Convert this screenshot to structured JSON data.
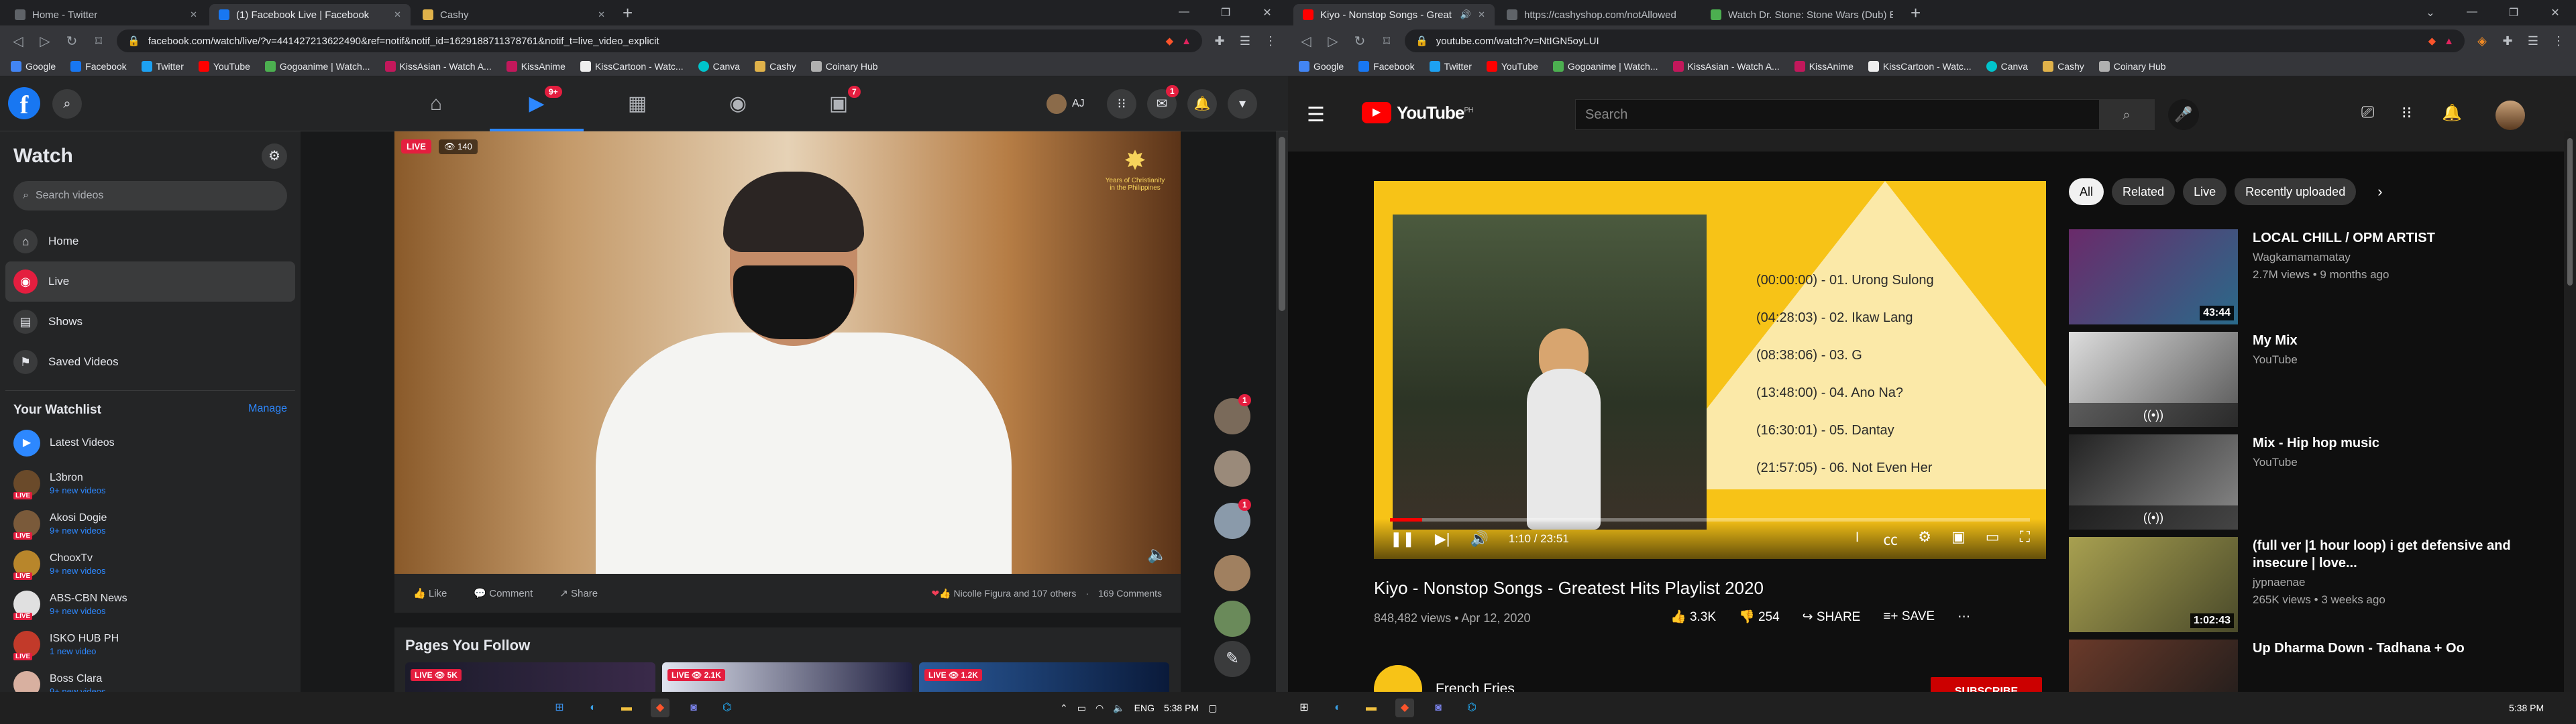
{
  "left_browser": {
    "tabs": [
      {
        "title": "Home - Twitter",
        "active": false
      },
      {
        "title": "(1) Facebook Live | Facebook",
        "active": true
      },
      {
        "title": "Cashy",
        "active": false
      }
    ],
    "url": "facebook.com/watch/live/?v=441427213622490&ref=notif&notif_id=1629188711378761&notif_t=live_video_explicit",
    "bookmarks": [
      "Google",
      "Facebook",
      "Twitter",
      "YouTube",
      "Gogoanime | Watch...",
      "KissAsian - Watch A...",
      "KissAnime",
      "KissCartoon - Watc...",
      "Canva",
      "Cashy",
      "Coinary Hub"
    ]
  },
  "facebook": {
    "user": "AJ",
    "nav_badges": {
      "watch": "9+",
      "gaming": "7",
      "messenger": "1"
    },
    "sidebar": {
      "title": "Watch",
      "search_placeholder": "Search videos",
      "items": [
        {
          "label": "Home",
          "icon": "home-icon"
        },
        {
          "label": "Live",
          "icon": "live-icon"
        },
        {
          "label": "Shows",
          "icon": "shows-icon"
        },
        {
          "label": "Saved Videos",
          "icon": "bookmark-icon"
        }
      ],
      "watchlist_title": "Your Watchlist",
      "manage": "Manage",
      "latest": "Latest Videos",
      "watchlist": [
        {
          "name": "L3bron",
          "sub": "9+ new videos"
        },
        {
          "name": "Akosi Dogie",
          "sub": "9+ new videos"
        },
        {
          "name": "ChooxTv",
          "sub": "9+ new videos"
        },
        {
          "name": "ABS-CBN News",
          "sub": "9+ new videos"
        },
        {
          "name": "ISKO HUB PH",
          "sub": "1 new video"
        },
        {
          "name": "Boss Clara",
          "sub": "9+ new videos"
        }
      ]
    },
    "video": {
      "live": "LIVE",
      "viewers": "140",
      "logo_text": "Years of Christianity in the Philippines"
    },
    "actions": {
      "like": "Like",
      "comment": "Comment",
      "share": "Share",
      "reactions": "Nicolle Figura and 107 others",
      "comments": "169 Comments"
    },
    "pages_title": "Pages You Follow",
    "page_cards": [
      {
        "live": "LIVE",
        "views": "5K"
      },
      {
        "live": "LIVE",
        "views": "2.1K"
      },
      {
        "live": "LIVE",
        "views": "1.2K"
      }
    ],
    "side_badges": [
      "1",
      "1"
    ]
  },
  "right_browser": {
    "tabs": [
      {
        "title": "Kiyo - Nonstop Songs - Great",
        "active": true
      },
      {
        "title": "https://cashyshop.com/notAllowed",
        "active": false
      },
      {
        "title": "Watch Dr. Stone: Stone Wars (Dub) Ep",
        "active": false
      }
    ],
    "url": "youtube.com/watch?v=NtIGN5oyLUI",
    "bookmarks": [
      "Google",
      "Facebook",
      "Twitter",
      "YouTube",
      "Gogoanime | Watch...",
      "KissAsian - Watch A...",
      "KissAnime",
      "KissCartoon - Watc...",
      "Canva",
      "Cashy",
      "Coinary Hub"
    ]
  },
  "youtube": {
    "logo": "YouTube",
    "region": "PH",
    "search_placeholder": "Search",
    "tracks": [
      "(00:00:00) - 01. Urong Sulong",
      "(04:28:03) - 02. Ikaw Lang",
      "(08:38:06) - 03. G",
      "(13:48:00) - 04. Ano Na?",
      "(16:30:01) - 05. Dantay",
      "(21:57:05) - 06. Not Even Her"
    ],
    "time": "1:10 / 23:51",
    "progress": 0.05,
    "title": "Kiyo - Nonstop Songs - Greatest Hits Playlist 2020",
    "meta": "848,482 views • Apr 12, 2020",
    "likes": "3.3K",
    "dislikes": "254",
    "share": "SHARE",
    "save": "SAVE",
    "channel": "French Fries",
    "subscribe": "SUBSCRIBE",
    "chips": [
      "All",
      "Related",
      "Live",
      "Recently uploaded"
    ],
    "recs": [
      {
        "title": "LOCAL CHILL / OPM ARTIST",
        "channel": "Wagkamamamatay",
        "meta": "2.7M views • 9 months ago",
        "dur": "43:44",
        "mix": false
      },
      {
        "title": "My Mix",
        "channel": "YouTube",
        "meta": "",
        "dur": "",
        "mix": true
      },
      {
        "title": "Mix - Hip hop music",
        "channel": "YouTube",
        "meta": "",
        "dur": "",
        "mix": true
      },
      {
        "title": "(full ver |1 hour loop) i get defensive and insecure | love...",
        "channel": "jypnaenae",
        "meta": "265K views • 3 weeks ago",
        "dur": "1:02:43",
        "mix": false
      },
      {
        "title": "Up Dharma Down - Tadhana + Oo",
        "channel": "",
        "meta": "",
        "dur": "",
        "mix": false
      }
    ]
  },
  "taskbar": {
    "lang": "ENG",
    "time_left": "5:38 PM",
    "time_right": "5:38 PM"
  },
  "colors": {
    "fb_blue": "#1877f2",
    "yt_red": "#ff0000",
    "live_red": "#e41e3f"
  }
}
